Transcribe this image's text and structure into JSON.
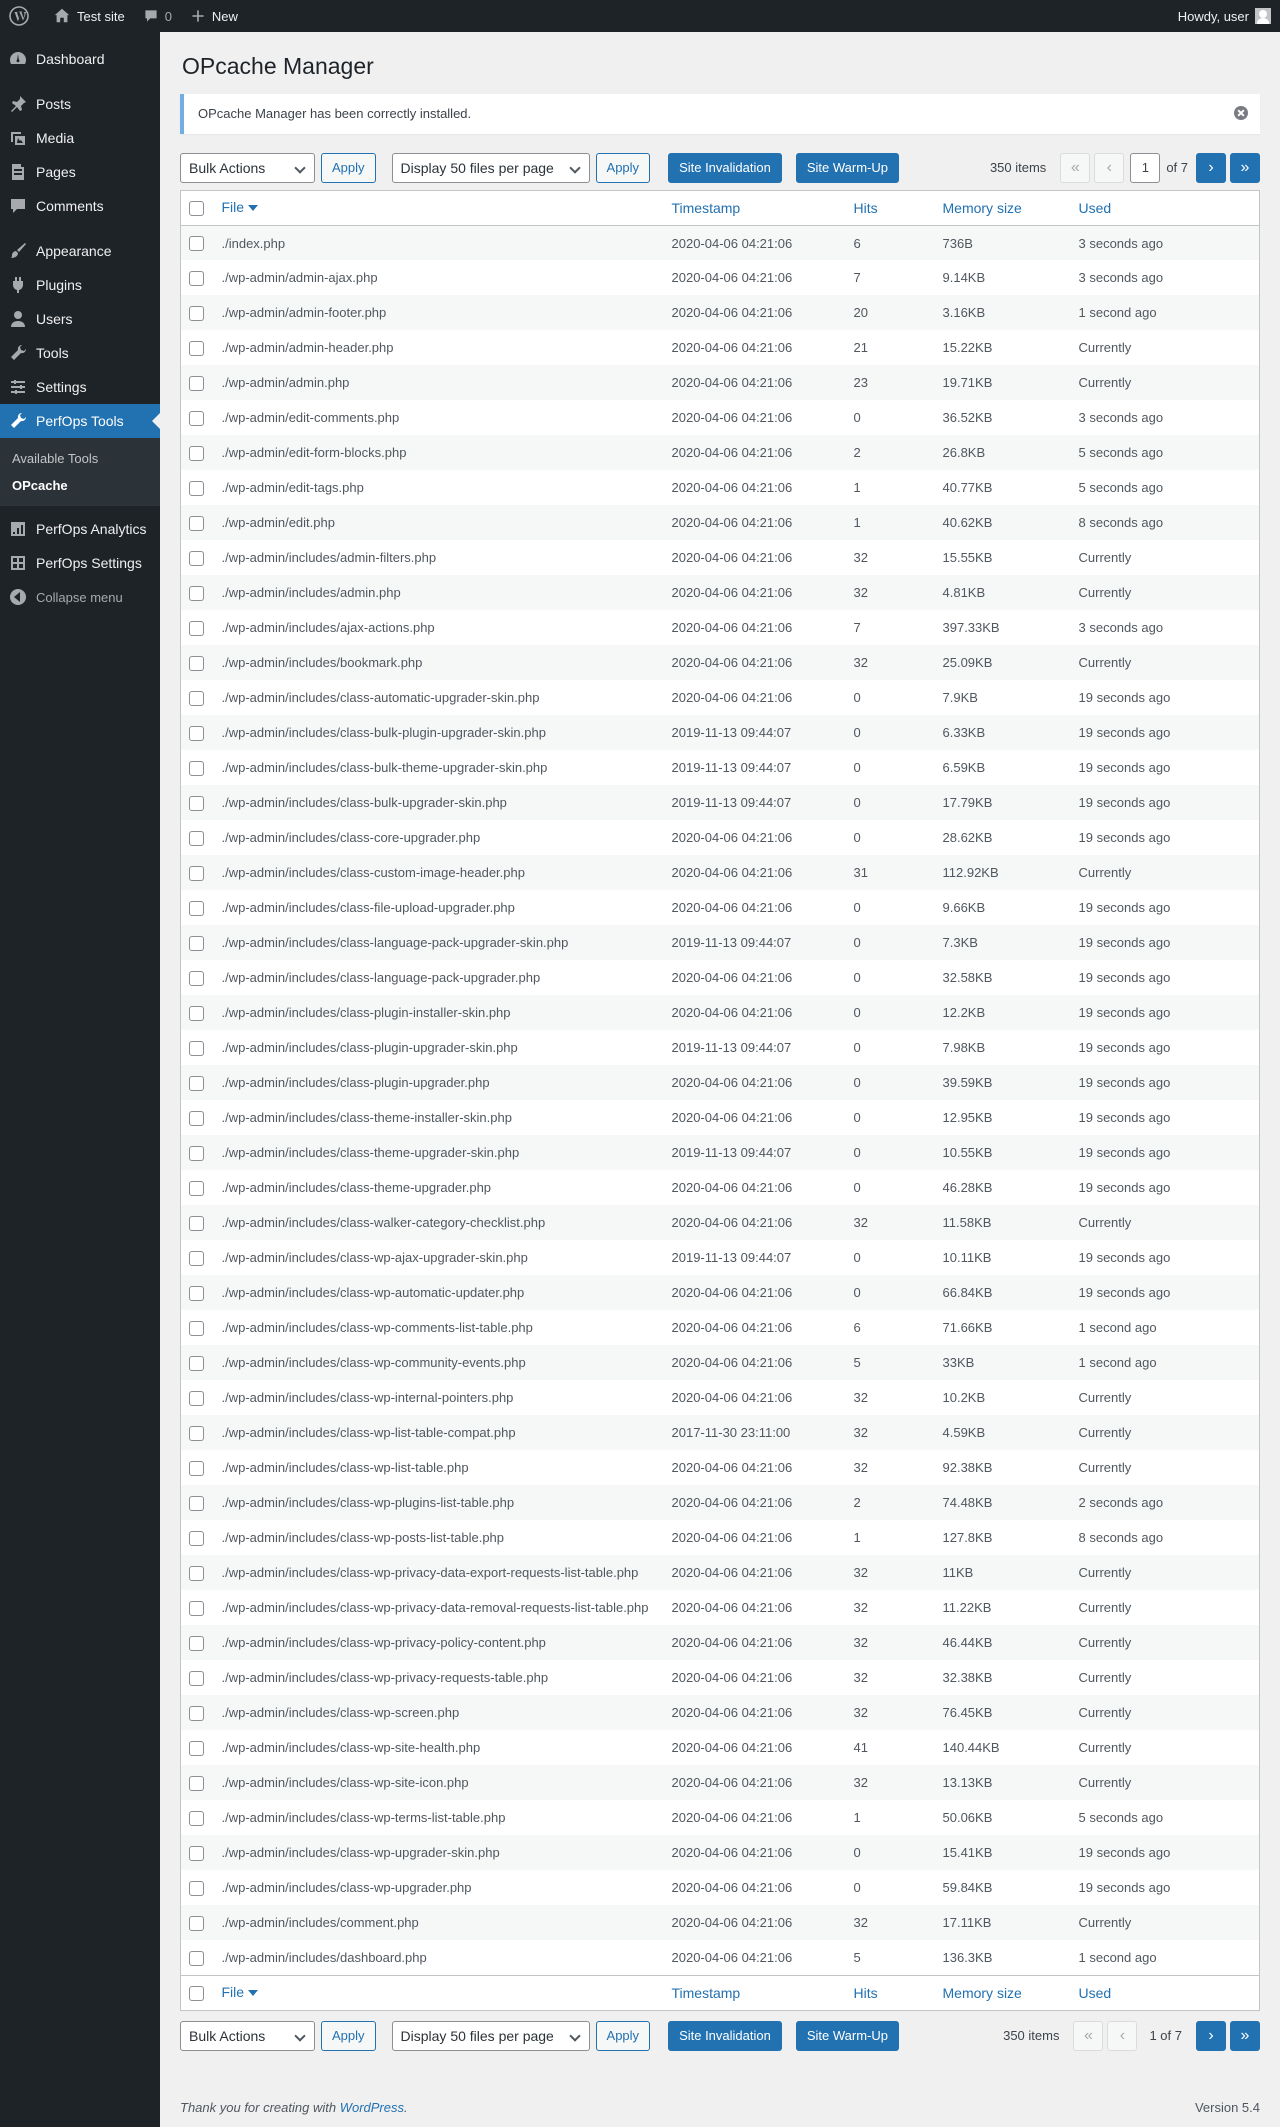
{
  "adminbar": {
    "site": "Test site",
    "comments": "0",
    "new": "New",
    "howdy": "Howdy, user"
  },
  "sidebar": {
    "items": [
      {
        "label": "Dashboard",
        "icon": "dashboard-icon"
      },
      {
        "label": "Posts",
        "icon": "pin-icon"
      },
      {
        "label": "Media",
        "icon": "media-icon"
      },
      {
        "label": "Pages",
        "icon": "page-icon"
      },
      {
        "label": "Comments",
        "icon": "comment-icon"
      },
      {
        "label": "Appearance",
        "icon": "paintbrush-icon"
      },
      {
        "label": "Plugins",
        "icon": "plugin-icon"
      },
      {
        "label": "Users",
        "icon": "users-icon"
      },
      {
        "label": "Tools",
        "icon": "wrench-icon"
      },
      {
        "label": "Settings",
        "icon": "settings-icon"
      },
      {
        "label": "PerfOps Tools",
        "icon": "wrench-icon"
      }
    ],
    "submenu": [
      "Available Tools",
      "OPcache"
    ],
    "after": [
      {
        "label": "PerfOps Analytics",
        "icon": "chart-icon"
      },
      {
        "label": "PerfOps Settings",
        "icon": "grid-icon"
      }
    ],
    "collapse": "Collapse menu"
  },
  "page": {
    "title": "OPcache Manager",
    "notice": "OPcache Manager has been correctly installed."
  },
  "toolbar": {
    "bulk": "Bulk Actions",
    "apply": "Apply",
    "display": "Display 50 files per page",
    "invalidate": "Site Invalidation",
    "warmup": "Site Warm-Up",
    "items": "350 items",
    "first": "«",
    "prev": "‹",
    "page": "1",
    "of": "of 7",
    "page_text": "1 of 7",
    "next": "›",
    "last": "»"
  },
  "table": {
    "columns": [
      "File",
      "Timestamp",
      "Hits",
      "Memory size",
      "Used"
    ],
    "rows": [
      [
        "./index.php",
        "2020-04-06 04:21:06",
        "6",
        "736B",
        "3 seconds ago"
      ],
      [
        "./wp-admin/admin-ajax.php",
        "2020-04-06 04:21:06",
        "7",
        "9.14KB",
        "3 seconds ago"
      ],
      [
        "./wp-admin/admin-footer.php",
        "2020-04-06 04:21:06",
        "20",
        "3.16KB",
        "1 second ago"
      ],
      [
        "./wp-admin/admin-header.php",
        "2020-04-06 04:21:06",
        "21",
        "15.22KB",
        "Currently"
      ],
      [
        "./wp-admin/admin.php",
        "2020-04-06 04:21:06",
        "23",
        "19.71KB",
        "Currently"
      ],
      [
        "./wp-admin/edit-comments.php",
        "2020-04-06 04:21:06",
        "0",
        "36.52KB",
        "3 seconds ago"
      ],
      [
        "./wp-admin/edit-form-blocks.php",
        "2020-04-06 04:21:06",
        "2",
        "26.8KB",
        "5 seconds ago"
      ],
      [
        "./wp-admin/edit-tags.php",
        "2020-04-06 04:21:06",
        "1",
        "40.77KB",
        "5 seconds ago"
      ],
      [
        "./wp-admin/edit.php",
        "2020-04-06 04:21:06",
        "1",
        "40.62KB",
        "8 seconds ago"
      ],
      [
        "./wp-admin/includes/admin-filters.php",
        "2020-04-06 04:21:06",
        "32",
        "15.55KB",
        "Currently"
      ],
      [
        "./wp-admin/includes/admin.php",
        "2020-04-06 04:21:06",
        "32",
        "4.81KB",
        "Currently"
      ],
      [
        "./wp-admin/includes/ajax-actions.php",
        "2020-04-06 04:21:06",
        "7",
        "397.33KB",
        "3 seconds ago"
      ],
      [
        "./wp-admin/includes/bookmark.php",
        "2020-04-06 04:21:06",
        "32",
        "25.09KB",
        "Currently"
      ],
      [
        "./wp-admin/includes/class-automatic-upgrader-skin.php",
        "2020-04-06 04:21:06",
        "0",
        "7.9KB",
        "19 seconds ago"
      ],
      [
        "./wp-admin/includes/class-bulk-plugin-upgrader-skin.php",
        "2019-11-13 09:44:07",
        "0",
        "6.33KB",
        "19 seconds ago"
      ],
      [
        "./wp-admin/includes/class-bulk-theme-upgrader-skin.php",
        "2019-11-13 09:44:07",
        "0",
        "6.59KB",
        "19 seconds ago"
      ],
      [
        "./wp-admin/includes/class-bulk-upgrader-skin.php",
        "2019-11-13 09:44:07",
        "0",
        "17.79KB",
        "19 seconds ago"
      ],
      [
        "./wp-admin/includes/class-core-upgrader.php",
        "2020-04-06 04:21:06",
        "0",
        "28.62KB",
        "19 seconds ago"
      ],
      [
        "./wp-admin/includes/class-custom-image-header.php",
        "2020-04-06 04:21:06",
        "31",
        "112.92KB",
        "Currently"
      ],
      [
        "./wp-admin/includes/class-file-upload-upgrader.php",
        "2020-04-06 04:21:06",
        "0",
        "9.66KB",
        "19 seconds ago"
      ],
      [
        "./wp-admin/includes/class-language-pack-upgrader-skin.php",
        "2019-11-13 09:44:07",
        "0",
        "7.3KB",
        "19 seconds ago"
      ],
      [
        "./wp-admin/includes/class-language-pack-upgrader.php",
        "2020-04-06 04:21:06",
        "0",
        "32.58KB",
        "19 seconds ago"
      ],
      [
        "./wp-admin/includes/class-plugin-installer-skin.php",
        "2020-04-06 04:21:06",
        "0",
        "12.2KB",
        "19 seconds ago"
      ],
      [
        "./wp-admin/includes/class-plugin-upgrader-skin.php",
        "2019-11-13 09:44:07",
        "0",
        "7.98KB",
        "19 seconds ago"
      ],
      [
        "./wp-admin/includes/class-plugin-upgrader.php",
        "2020-04-06 04:21:06",
        "0",
        "39.59KB",
        "19 seconds ago"
      ],
      [
        "./wp-admin/includes/class-theme-installer-skin.php",
        "2020-04-06 04:21:06",
        "0",
        "12.95KB",
        "19 seconds ago"
      ],
      [
        "./wp-admin/includes/class-theme-upgrader-skin.php",
        "2019-11-13 09:44:07",
        "0",
        "10.55KB",
        "19 seconds ago"
      ],
      [
        "./wp-admin/includes/class-theme-upgrader.php",
        "2020-04-06 04:21:06",
        "0",
        "46.28KB",
        "19 seconds ago"
      ],
      [
        "./wp-admin/includes/class-walker-category-checklist.php",
        "2020-04-06 04:21:06",
        "32",
        "11.58KB",
        "Currently"
      ],
      [
        "./wp-admin/includes/class-wp-ajax-upgrader-skin.php",
        "2019-11-13 09:44:07",
        "0",
        "10.11KB",
        "19 seconds ago"
      ],
      [
        "./wp-admin/includes/class-wp-automatic-updater.php",
        "2020-04-06 04:21:06",
        "0",
        "66.84KB",
        "19 seconds ago"
      ],
      [
        "./wp-admin/includes/class-wp-comments-list-table.php",
        "2020-04-06 04:21:06",
        "6",
        "71.66KB",
        "1 second ago"
      ],
      [
        "./wp-admin/includes/class-wp-community-events.php",
        "2020-04-06 04:21:06",
        "5",
        "33KB",
        "1 second ago"
      ],
      [
        "./wp-admin/includes/class-wp-internal-pointers.php",
        "2020-04-06 04:21:06",
        "32",
        "10.2KB",
        "Currently"
      ],
      [
        "./wp-admin/includes/class-wp-list-table-compat.php",
        "2017-11-30 23:11:00",
        "32",
        "4.59KB",
        "Currently"
      ],
      [
        "./wp-admin/includes/class-wp-list-table.php",
        "2020-04-06 04:21:06",
        "32",
        "92.38KB",
        "Currently"
      ],
      [
        "./wp-admin/includes/class-wp-plugins-list-table.php",
        "2020-04-06 04:21:06",
        "2",
        "74.48KB",
        "2 seconds ago"
      ],
      [
        "./wp-admin/includes/class-wp-posts-list-table.php",
        "2020-04-06 04:21:06",
        "1",
        "127.8KB",
        "8 seconds ago"
      ],
      [
        "./wp-admin/includes/class-wp-privacy-data-export-requests-list-table.php",
        "2020-04-06 04:21:06",
        "32",
        "11KB",
        "Currently"
      ],
      [
        "./wp-admin/includes/class-wp-privacy-data-removal-requests-list-table.php",
        "2020-04-06 04:21:06",
        "32",
        "11.22KB",
        "Currently"
      ],
      [
        "./wp-admin/includes/class-wp-privacy-policy-content.php",
        "2020-04-06 04:21:06",
        "32",
        "46.44KB",
        "Currently"
      ],
      [
        "./wp-admin/includes/class-wp-privacy-requests-table.php",
        "2020-04-06 04:21:06",
        "32",
        "32.38KB",
        "Currently"
      ],
      [
        "./wp-admin/includes/class-wp-screen.php",
        "2020-04-06 04:21:06",
        "32",
        "76.45KB",
        "Currently"
      ],
      [
        "./wp-admin/includes/class-wp-site-health.php",
        "2020-04-06 04:21:06",
        "41",
        "140.44KB",
        "Currently"
      ],
      [
        "./wp-admin/includes/class-wp-site-icon.php",
        "2020-04-06 04:21:06",
        "32",
        "13.13KB",
        "Currently"
      ],
      [
        "./wp-admin/includes/class-wp-terms-list-table.php",
        "2020-04-06 04:21:06",
        "1",
        "50.06KB",
        "5 seconds ago"
      ],
      [
        "./wp-admin/includes/class-wp-upgrader-skin.php",
        "2020-04-06 04:21:06",
        "0",
        "15.41KB",
        "19 seconds ago"
      ],
      [
        "./wp-admin/includes/class-wp-upgrader.php",
        "2020-04-06 04:21:06",
        "0",
        "59.84KB",
        "19 seconds ago"
      ],
      [
        "./wp-admin/includes/comment.php",
        "2020-04-06 04:21:06",
        "32",
        "17.11KB",
        "Currently"
      ],
      [
        "./wp-admin/includes/dashboard.php",
        "2020-04-06 04:21:06",
        "5",
        "136.3KB",
        "1 second ago"
      ]
    ]
  },
  "footer": {
    "thanks": "Thank you for creating with ",
    "wp": "WordPress",
    "dot": ".",
    "version": "Version 5.4"
  }
}
